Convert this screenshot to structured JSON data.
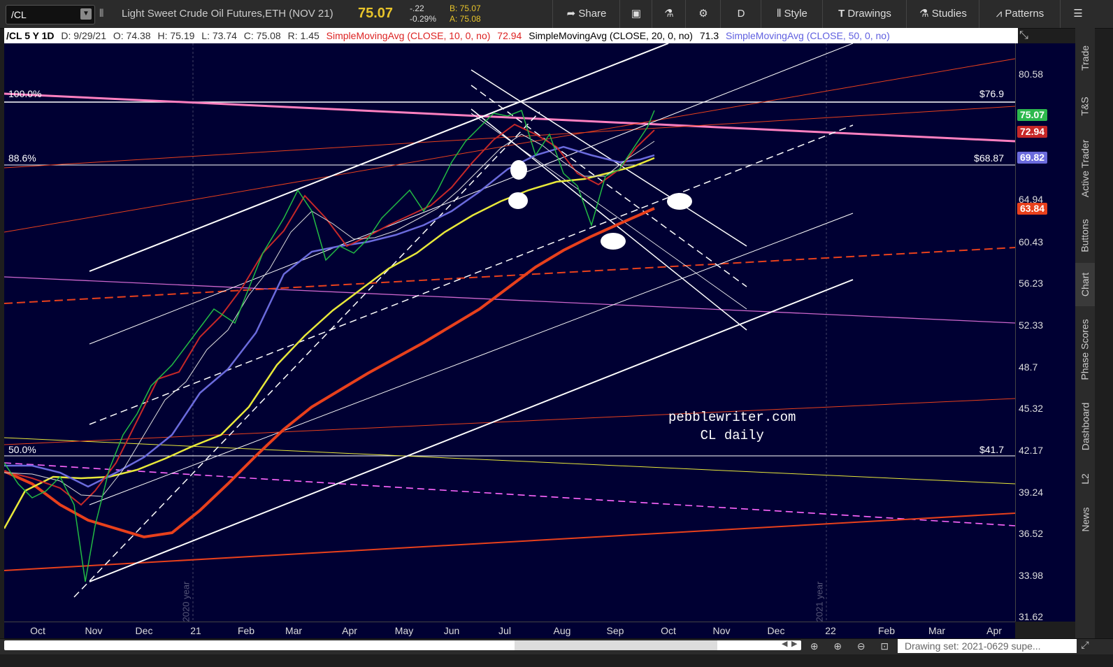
{
  "toolbar": {
    "symbol": "/CL",
    "description": "Light Sweet Crude Oil Futures,ETH (NOV 21)",
    "last": "75.07",
    "change": "-.22",
    "change_pct": "-0.29%",
    "bid": "B: 75.07",
    "ask": "A: 75.08",
    "share_label": "Share",
    "aggregation": "D",
    "style_label": "Style",
    "drawings_label": "Drawings",
    "studies_label": "Studies",
    "patterns_label": "Patterns"
  },
  "infobar": {
    "symbol": "/CL 5 Y 1D",
    "date": "D: 9/29/21",
    "open": "O: 74.38",
    "high": "H: 75.19",
    "low": "L: 73.74",
    "close": "C: 75.08",
    "range": "R: 1.45",
    "sma10_label": "SimpleMovingAvg (CLOSE, 10, 0, no)",
    "sma10_value": "72.94",
    "sma20_label": "SimpleMovingAvg (CLOSE, 20, 0, no)",
    "sma20_value": "71.3",
    "sma50_label": "SimpleMovingAvg (CLOSE, 50, 0, no)"
  },
  "y_axis": {
    "ticks": [
      "80.58",
      "64.94",
      "60.43",
      "56.23",
      "52.33",
      "48.7",
      "45.32",
      "42.17",
      "39.24",
      "36.52",
      "33.98",
      "31.62"
    ],
    "badges": [
      {
        "text": "75.07",
        "color": "#2db84d"
      },
      {
        "text": "72.94",
        "color": "#c62828"
      },
      {
        "text": "69.82",
        "color": "#6b6bdd"
      },
      {
        "text": "63.84",
        "color": "#e8401c"
      }
    ]
  },
  "x_axis": {
    "ticks": [
      "Oct",
      "Nov",
      "Dec",
      "21",
      "Feb",
      "Mar",
      "Apr",
      "May",
      "Jun",
      "Jul",
      "Aug",
      "Sep",
      "Oct",
      "Nov",
      "Dec",
      "22",
      "Feb",
      "Mar",
      "Apr"
    ]
  },
  "fib_levels": [
    {
      "pct": "100.0%",
      "price": "$76.9"
    },
    {
      "pct": "88.6%",
      "price": "$68.87"
    },
    {
      "pct": "50.0%",
      "price": "$41.7"
    }
  ],
  "year_markers": [
    "2020 year",
    "2021 year"
  ],
  "watermark": {
    "line1": "pebblewriter.com",
    "line2": "CL daily"
  },
  "sidebar": [
    "Trade",
    "T&S",
    "Active Trader",
    "Buttons",
    "Chart",
    "Phase Scores",
    "Dashboard",
    "L2",
    "News"
  ],
  "bottom": {
    "drawing_set": "Drawing set: 2021-0629 supe..."
  },
  "colors": {
    "plot_bg": "#000033",
    "sma10": "#c62828",
    "sma50": "#6b6bdd",
    "sma100": "#e8e83a",
    "sma200": "#e8401c"
  }
}
